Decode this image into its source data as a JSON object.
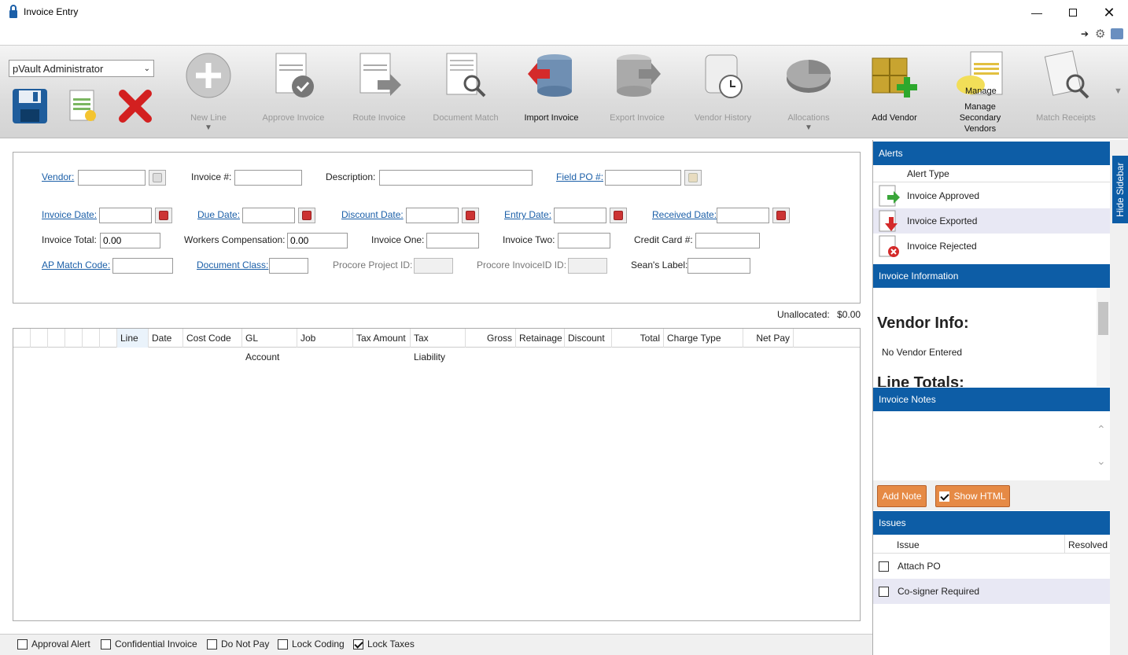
{
  "window": {
    "title": "Invoice Entry"
  },
  "user_select": {
    "value": "pVault Administrator"
  },
  "ribbon": {
    "items": [
      {
        "label": "New Line",
        "enabled": false
      },
      {
        "label": "Approve Invoice",
        "enabled": false
      },
      {
        "label": "Route Invoice",
        "enabled": false
      },
      {
        "label": "Document Match",
        "enabled": false
      },
      {
        "label": "Import Invoice",
        "enabled": true
      },
      {
        "label": "Export Invoice",
        "enabled": false
      },
      {
        "label": "Vendor History",
        "enabled": false
      },
      {
        "label": "Allocations",
        "enabled": false
      },
      {
        "label": "Add Vendor",
        "enabled": true
      },
      {
        "label": "Manage Secondary Vendors",
        "enabled": true
      },
      {
        "label": "Match Receipts",
        "enabled": false
      }
    ],
    "manage_badge": "Manage"
  },
  "form": {
    "vendor_label": "Vendor:",
    "invoice_num_label": "Invoice #:",
    "description_label": "Description:",
    "field_po_label": "Field PO #:",
    "invoice_date_label": "Invoice Date:",
    "due_date_label": "Due Date:",
    "discount_date_label": "Discount Date:",
    "entry_date_label": "Entry Date:",
    "received_date_label": "Received Date:",
    "invoice_total_label": "Invoice Total:",
    "invoice_total_value": "0.00",
    "workers_comp_label": "Workers Compensation:",
    "workers_comp_value": "0.00",
    "invoice_one_label": "Invoice One:",
    "invoice_two_label": "Invoice Two:",
    "credit_card_label": "Credit Card #:",
    "ap_match_label": "AP Match Code:",
    "doc_class_label": "Document Class:",
    "procore_project_label": "Procore Project ID:",
    "procore_invoice_label": "Procore InvoiceID ID:",
    "seans_label": "Sean's Label:"
  },
  "unallocated": {
    "label": "Unallocated:",
    "value": "$0.00"
  },
  "grid": {
    "columns": [
      "Line",
      "Date",
      "Cost Code",
      "GL Account",
      "Job",
      "Tax Amount",
      "Tax Liability",
      "Gross",
      "Retainage",
      "Discount",
      "Total",
      "Charge Type",
      "Net Pay"
    ]
  },
  "bottom": {
    "checks": [
      {
        "label": "Approval Alert",
        "checked": false
      },
      {
        "label": "Confidential Invoice",
        "checked": false
      },
      {
        "label": "Do Not Pay",
        "checked": false
      },
      {
        "label": "Lock Coding",
        "checked": false
      },
      {
        "label": "Lock Taxes",
        "checked": true
      }
    ]
  },
  "sidebar": {
    "hide_label": "Hide Sidebar",
    "alerts": {
      "title": "Alerts",
      "column": "Alert Type",
      "rows": [
        "Invoice Approved",
        "Invoice Exported",
        "Invoice Rejected"
      ]
    },
    "invoice_info": {
      "title": "Invoice Information",
      "vendor_info": "Vendor Info:",
      "no_vendor": "No Vendor Entered",
      "line_totals": "Line Totals:"
    },
    "notes": {
      "title": "Invoice Notes",
      "add_note": "Add Note",
      "show_html": "Show HTML",
      "show_html_checked": true
    },
    "issues": {
      "title": "Issues",
      "col_issue": "Issue",
      "col_resolved": "Resolved",
      "rows": [
        "Attach PO",
        "Co-signer Required"
      ]
    }
  },
  "colors": {
    "accent": "#0d5da6",
    "link": "#1b5fa8",
    "orange": "#e68a45"
  }
}
